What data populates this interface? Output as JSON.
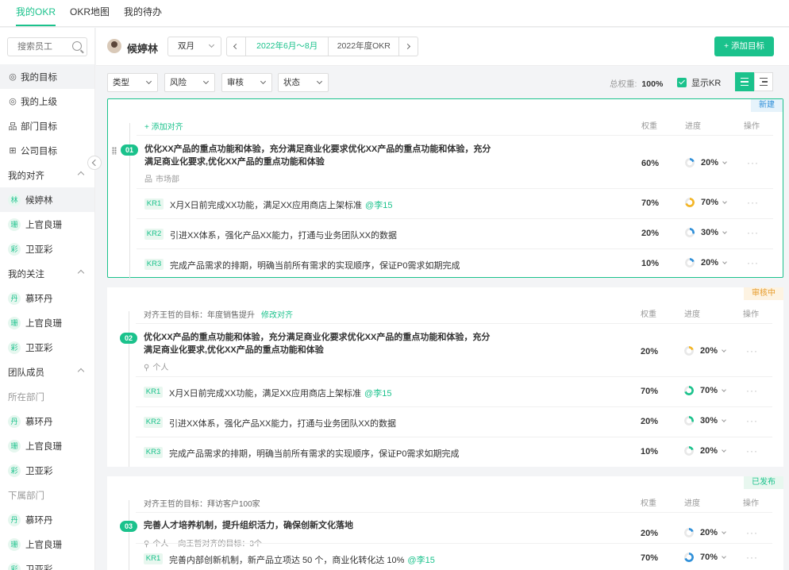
{
  "tabs": [
    {
      "label": "我的OKR",
      "active": true
    },
    {
      "label": "OKR地图",
      "active": false
    },
    {
      "label": "我的待办",
      "active": false
    }
  ],
  "sidebar": {
    "search_placeholder": "搜索员工",
    "items": [
      {
        "label": "我的目标",
        "icon": "target-icon",
        "active": true
      },
      {
        "label": "我的上级",
        "icon": "target-icon"
      },
      {
        "label": "部门目标",
        "icon": "org-icon"
      },
      {
        "label": "公司目标",
        "icon": "building-icon"
      }
    ],
    "my_alignment": {
      "label": "我的对齐",
      "members": [
        {
          "avatar": "林",
          "name": "候婷林",
          "active": true
        },
        {
          "avatar": "珊",
          "name": "上官良珊"
        },
        {
          "avatar": "彩",
          "name": "卫亚彩"
        }
      ]
    },
    "my_follow": {
      "label": "我的关注",
      "members": [
        {
          "avatar": "丹",
          "name": "慕环丹"
        },
        {
          "avatar": "珊",
          "name": "上官良珊"
        },
        {
          "avatar": "彩",
          "name": "卫亚彩"
        }
      ]
    },
    "team": {
      "label": "团队成员",
      "dept_label": "所在部门",
      "dept_members": [
        {
          "avatar": "丹",
          "name": "慕环丹"
        },
        {
          "avatar": "珊",
          "name": "上官良珊"
        },
        {
          "avatar": "彩",
          "name": "卫亚彩"
        }
      ],
      "sub_label": "下属部门",
      "sub_members": [
        {
          "avatar": "丹",
          "name": "慕环丹"
        },
        {
          "avatar": "珊",
          "name": "上官良珊"
        },
        {
          "avatar": "彩",
          "name": "卫亚彩"
        }
      ]
    }
  },
  "header": {
    "user_name": "候婷林",
    "period": "双月",
    "date_range": "2022年6月～8月",
    "okr_year": "2022年度OKR",
    "add_button": "+ 添加目标"
  },
  "filters": {
    "selects": [
      "类型",
      "风险",
      "审核",
      "状态"
    ],
    "total_weight_label": "总权重:",
    "total_weight_value": "100%",
    "show_kr_label": "显示KR",
    "show_kr_checked": true
  },
  "columns": {
    "weight": "权重",
    "progress": "进度",
    "ops": "操作"
  },
  "colors": {
    "accent": "#1bc28c",
    "new": "#2f8fd8",
    "review": "#e69b2a"
  },
  "objectives": [
    {
      "badge": "新建",
      "align_text": "",
      "align_link": "+ 添加对齐",
      "num": "01",
      "title_1": "优化XX产品的重点功能和体验，充分满足商业化要求优化XX产品的重点功能和体验，充分",
      "title_2": "满足商业化要求,优化XX产品的重点功能和体验",
      "meta": "市场部",
      "meta_extra": "",
      "weight": "60%",
      "progress": "20%",
      "progress_value": 20,
      "ops": "···",
      "krs": [
        {
          "tag": "KR1",
          "text": "X月X日前完成XX功能，满足XX应用商店上架标准",
          "mention": "@李15",
          "weight": "70%",
          "progress": "70%",
          "progress_value": 70,
          "ring_color": "#f3b526"
        },
        {
          "tag": "KR2",
          "text": "引进XX体系，强化产品XX能力，打通与业务团队XX的数据",
          "mention": "",
          "weight": "20%",
          "progress": "30%",
          "progress_value": 30,
          "ring_color": "#2f8fd8"
        },
        {
          "tag": "KR3",
          "text": "完成产品需求的排期，明确当前所有需求的实现顺序，保证P0需求如期完成",
          "mention": "",
          "weight": "10%",
          "progress": "20%",
          "progress_value": 20,
          "ring_color": "#2f8fd8"
        }
      ]
    },
    {
      "badge": "审核中",
      "align_text": "对齐王哲的目标：年度销售提升",
      "align_link": "修改对齐",
      "num": "02",
      "title_1": "优化XX产品的重点功能和体验，充分满足商业化要求优化XX产品的重点功能和体验，充分",
      "title_2": "满足商业化要求,优化XX产品的重点功能和体验",
      "meta": "个人",
      "meta_extra": "",
      "weight": "20%",
      "progress": "20%",
      "progress_value": 20,
      "ops": "···",
      "krs": [
        {
          "tag": "KR1",
          "text": "X月X日前完成XX功能，满足XX应用商店上架标准",
          "mention": "@李15",
          "weight": "70%",
          "progress": "70%",
          "progress_value": 70,
          "ring_color": "#1bc28c"
        },
        {
          "tag": "KR2",
          "text": "引进XX体系，强化产品XX能力，打通与业务团队XX的数据",
          "mention": "",
          "weight": "20%",
          "progress": "30%",
          "progress_value": 30,
          "ring_color": "#1bc28c"
        },
        {
          "tag": "KR3",
          "text": "完成产品需求的排期，明确当前所有需求的实现顺序，保证P0需求如期完成",
          "mention": "",
          "weight": "10%",
          "progress": "20%",
          "progress_value": 20,
          "ring_color": "#1bc28c"
        }
      ]
    },
    {
      "badge": "已发布",
      "align_text": "对齐王哲的目标：拜访客户100家",
      "align_link": "",
      "num": "03",
      "title_1": "完善人才培养机制，提升组织活力，确保创新文化落地",
      "title_2": "",
      "meta": "个人",
      "meta_extra": "向王哲对齐的目标：3个",
      "weight": "20%",
      "progress": "20%",
      "progress_value": 20,
      "ops": "···",
      "krs": [
        {
          "tag": "KR1",
          "text": "完善内部创新机制，新产品立项达 50 个，商业化转化达 10%",
          "mention": "@李15",
          "weight": "70%",
          "progress": "70%",
          "progress_value": 70,
          "ring_color": "#2f8fd8"
        }
      ]
    }
  ]
}
